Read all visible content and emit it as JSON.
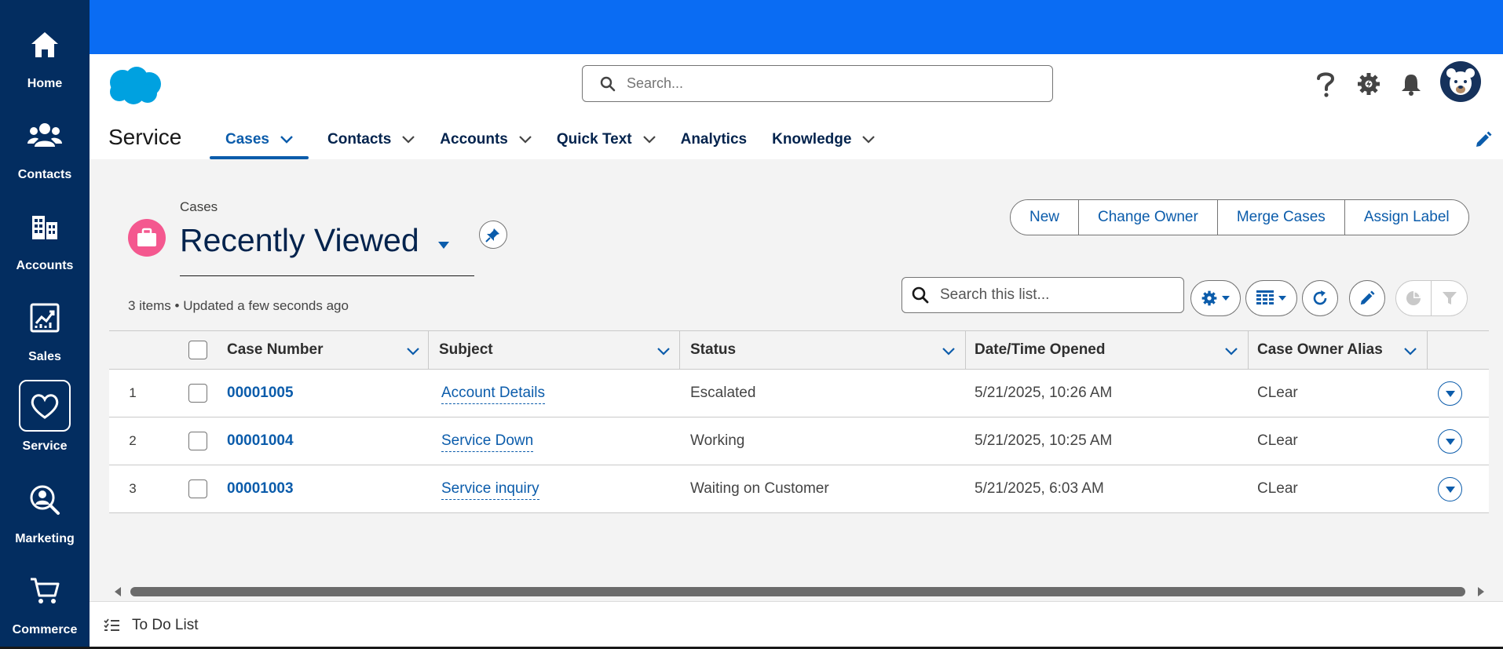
{
  "rail": {
    "items": [
      {
        "label": "Home",
        "icon": "home-icon"
      },
      {
        "label": "Contacts",
        "icon": "contacts-icon"
      },
      {
        "label": "Accounts",
        "icon": "accounts-icon"
      },
      {
        "label": "Sales",
        "icon": "sales-icon"
      },
      {
        "label": "Service",
        "icon": "heart-icon",
        "active": true
      },
      {
        "label": "Marketing",
        "icon": "marketing-icon"
      },
      {
        "label": "Commerce",
        "icon": "cart-icon"
      }
    ]
  },
  "header": {
    "search_placeholder": "Search...",
    "app_name": "Service",
    "nav": [
      {
        "label": "Cases",
        "active": true,
        "has_menu": true
      },
      {
        "label": "Contacts",
        "has_menu": true
      },
      {
        "label": "Accounts",
        "has_menu": true
      },
      {
        "label": "Quick Text",
        "has_menu": true
      },
      {
        "label": "Analytics",
        "has_menu": false
      },
      {
        "label": "Knowledge",
        "has_menu": true
      }
    ]
  },
  "list_view": {
    "object_label": "Cases",
    "title": "Recently Viewed",
    "status": "3 items • Updated a few seconds ago",
    "actions": [
      "New",
      "Change Owner",
      "Merge Cases",
      "Assign Label"
    ],
    "search_placeholder": "Search this list..."
  },
  "table": {
    "columns": [
      "Case Number",
      "Subject",
      "Status",
      "Date/Time Opened",
      "Case Owner Alias"
    ],
    "rows": [
      {
        "num": "1",
        "case_number": "00001005",
        "subject": "Account Details",
        "status": "Escalated",
        "opened": "5/21/2025, 10:26 AM",
        "owner": "CLear"
      },
      {
        "num": "2",
        "case_number": "00001004",
        "subject": "Service Down",
        "status": "Working",
        "opened": "5/21/2025, 10:25 AM",
        "owner": "CLear"
      },
      {
        "num": "3",
        "case_number": "00001003",
        "subject": "Service inquiry",
        "status": "Waiting on Customer",
        "opened": "5/21/2025, 6:03 AM",
        "owner": "CLear"
      }
    ]
  },
  "utility_bar": {
    "todo_label": "To Do List"
  },
  "colors": {
    "rail": "#032d60",
    "band": "#0a6cf3",
    "link": "#0b5cab",
    "case_icon": "#f4588f"
  }
}
